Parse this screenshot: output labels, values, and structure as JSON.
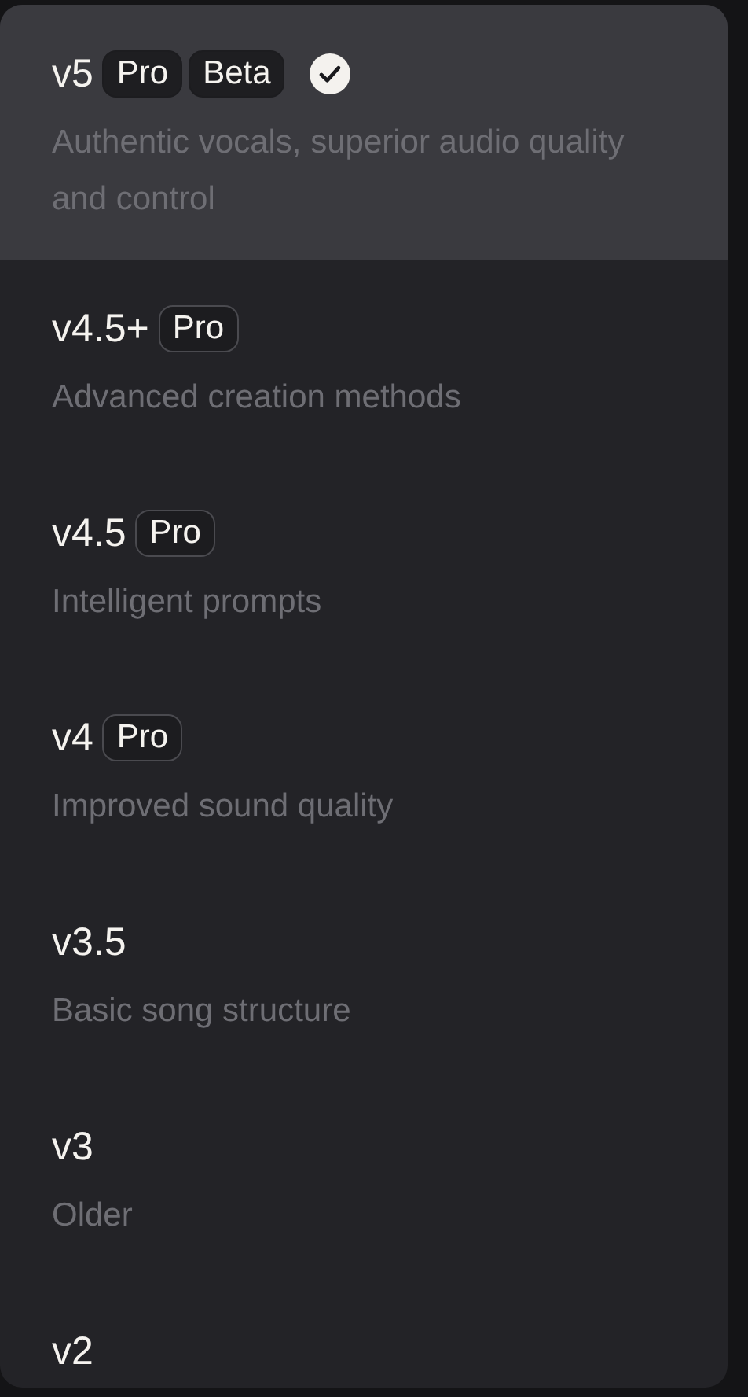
{
  "menu": {
    "items": [
      {
        "title": "v5",
        "badges": [
          "Pro",
          "Beta"
        ],
        "description": "Authentic vocals, superior audio quality and control",
        "selected": true
      },
      {
        "title": "v4.5+",
        "badges": [
          "Pro"
        ],
        "description": "Advanced creation methods",
        "selected": false
      },
      {
        "title": "v4.5",
        "badges": [
          "Pro"
        ],
        "description": "Intelligent prompts",
        "selected": false
      },
      {
        "title": "v4",
        "badges": [
          "Pro"
        ],
        "description": "Improved sound quality",
        "selected": false
      },
      {
        "title": "v3.5",
        "description": "Basic song structure",
        "selected": false
      },
      {
        "title": "v3",
        "description": "Older",
        "selected": false
      },
      {
        "title": "v2",
        "selected": false
      }
    ]
  }
}
